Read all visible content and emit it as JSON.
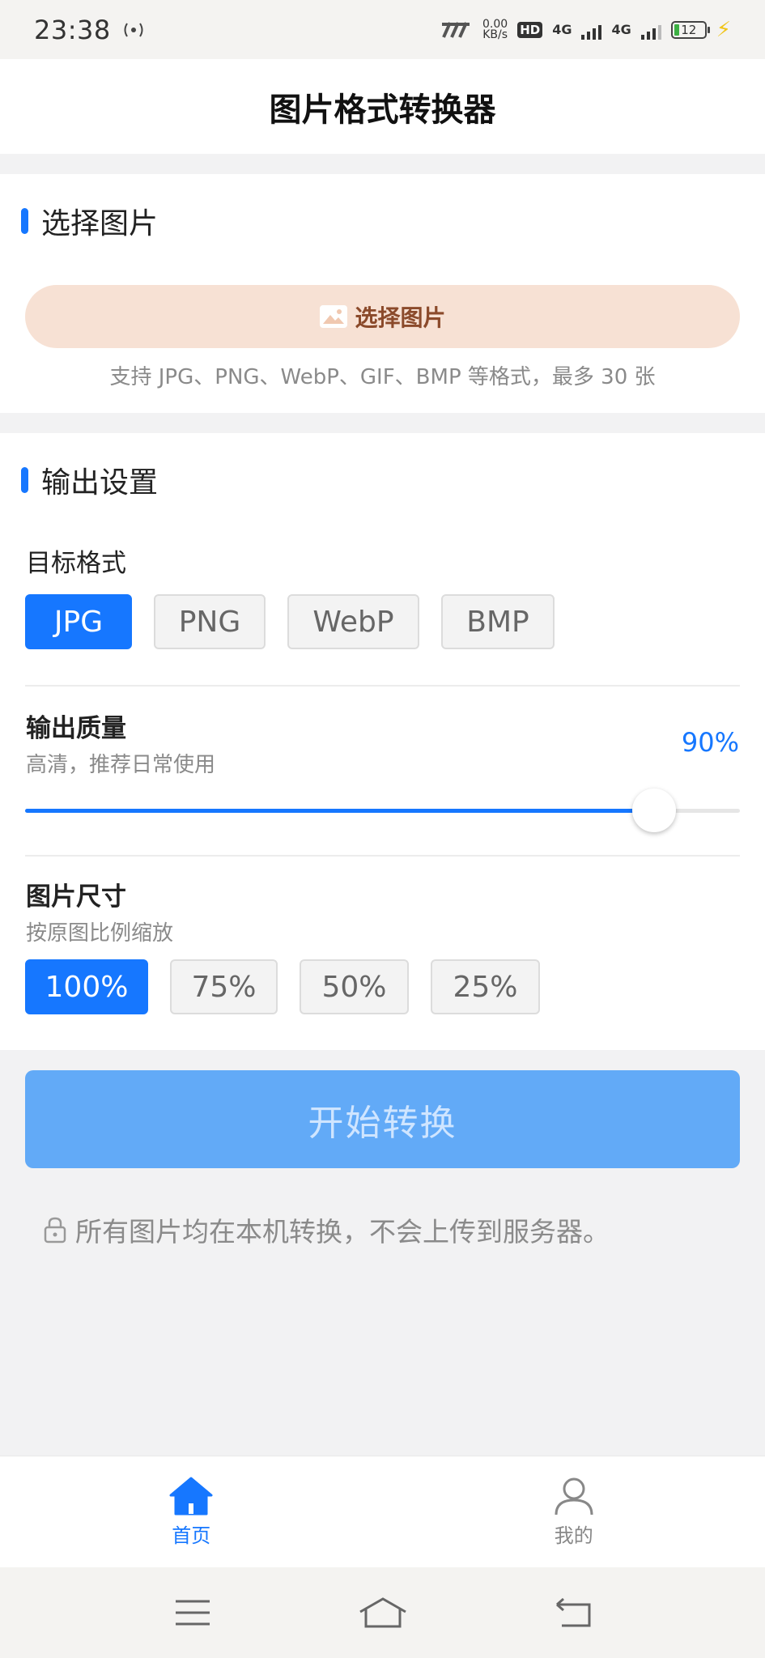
{
  "status_bar": {
    "time": "23:38",
    "net_speed_top": "0.00",
    "net_speed_bottom": "KB/s",
    "hd": "HD",
    "sim1": "4G",
    "sim2": "4G",
    "battery": "12"
  },
  "header": {
    "title": "图片格式转换器"
  },
  "select_section": {
    "title": "选择图片",
    "button_label": "选择图片",
    "hint": "支持 JPG、PNG、WebP、GIF、BMP 等格式，最多 30 张"
  },
  "output_section": {
    "title": "输出设置",
    "format_label": "目标格式",
    "formats": [
      "JPG",
      "PNG",
      "WebP",
      "BMP"
    ],
    "selected_format": "JPG",
    "quality_label": "输出质量",
    "quality_sub": "高清，推荐日常使用",
    "quality_value_text": "90%",
    "quality_fraction": 0.88,
    "size_label": "图片尺寸",
    "size_sub": "按原图比例缩放",
    "sizes": [
      "100%",
      "75%",
      "50%",
      "25%"
    ],
    "selected_size": "100%"
  },
  "start_button": {
    "label": "开始转换"
  },
  "privacy_note": "所有图片均在本机转换，不会上传到服务器。",
  "bottom_nav": {
    "home": "首页",
    "mine": "我的"
  },
  "colors": {
    "accent": "#1677ff",
    "select_button_bg": "#f7e1d4",
    "start_button_bg": "#62aaf7"
  }
}
